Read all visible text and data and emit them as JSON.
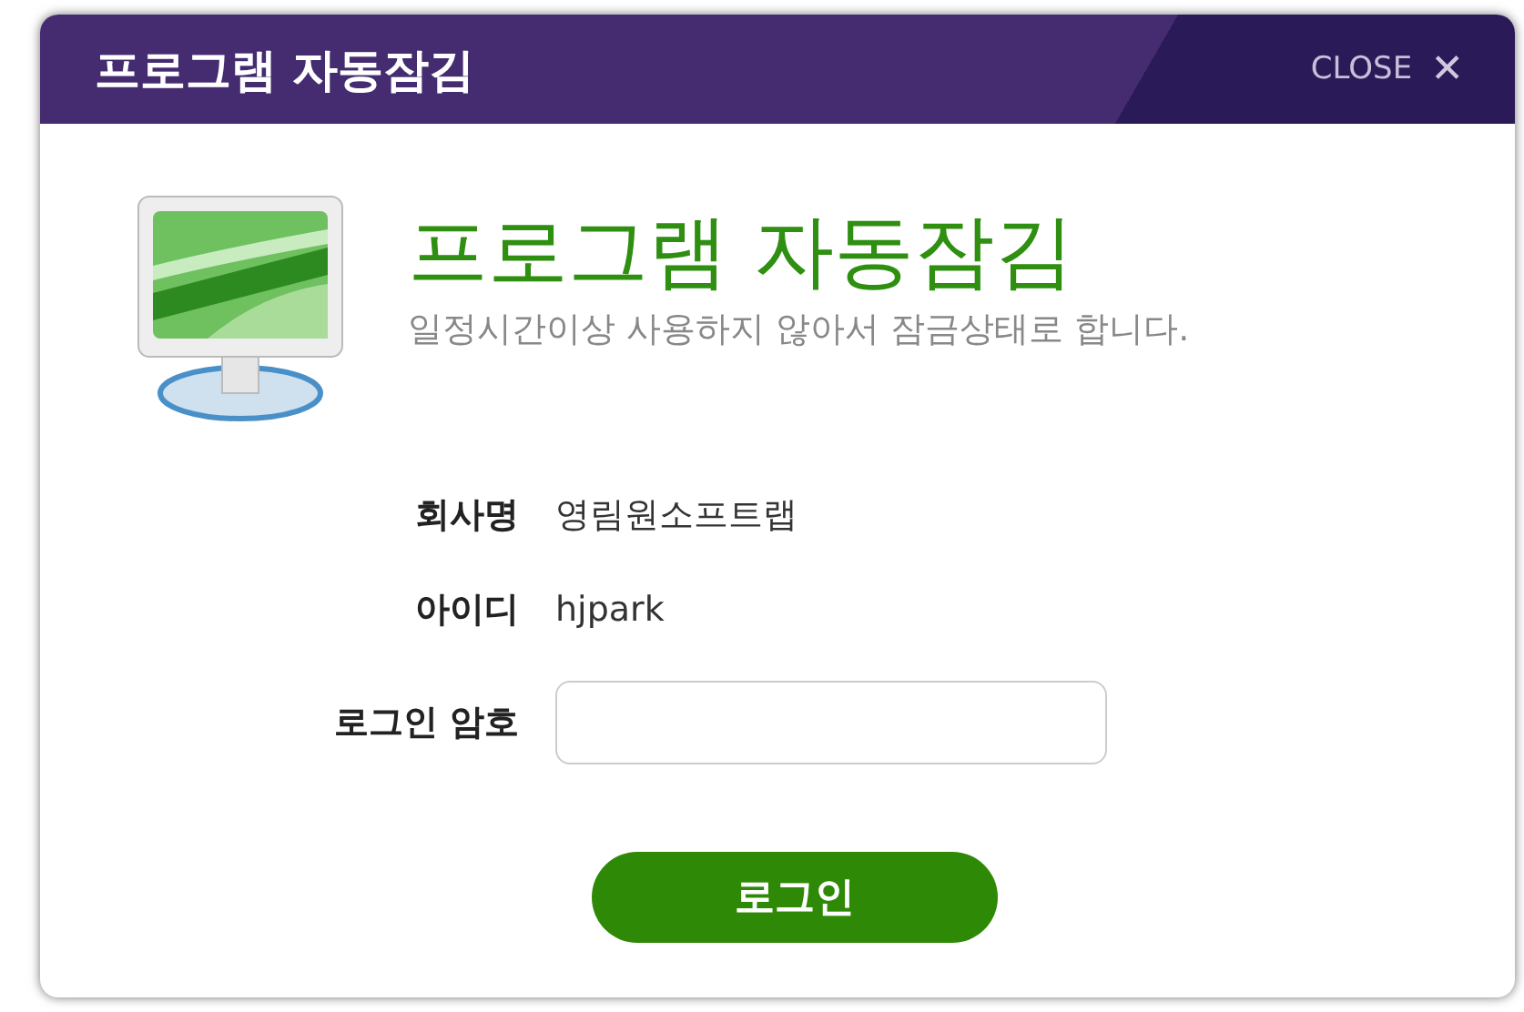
{
  "window": {
    "title": "프로그램 자동잠김",
    "close_label": "CLOSE",
    "close_glyph": "✕"
  },
  "heading": "프로그램 자동잠김",
  "message": "일정시간이상 사용하지 않아서 잠금상태로 합니다.",
  "fields": [
    {
      "kind": "text",
      "label": "회사명",
      "value": "영림원소프트랩"
    },
    {
      "kind": "text",
      "label": "아이디",
      "value": "hjpark"
    },
    {
      "kind": "input",
      "label": "로그인 암호"
    }
  ],
  "button": "로그인"
}
